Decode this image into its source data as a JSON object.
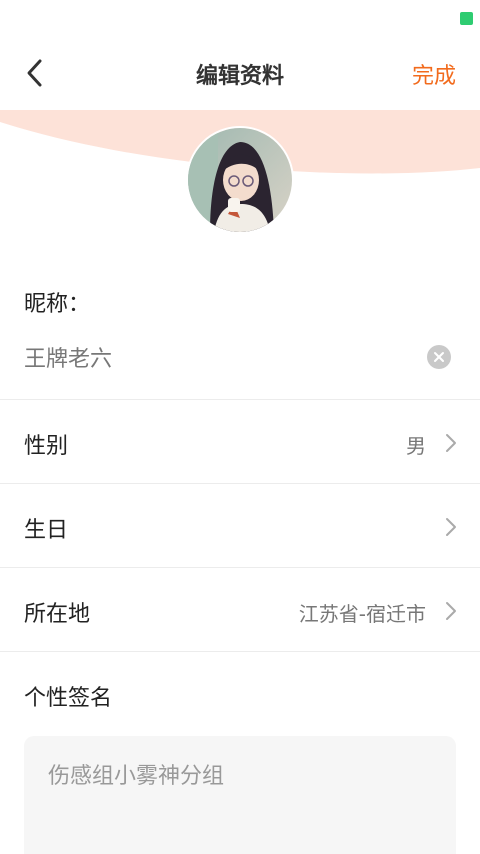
{
  "nav": {
    "title": "编辑资料",
    "done_label": "完成"
  },
  "profile": {
    "nickname_label": "昵称：",
    "nickname_value": "王牌老六"
  },
  "rows": {
    "gender": {
      "label": "性别",
      "value": "男"
    },
    "birthday": {
      "label": "生日",
      "value": ""
    },
    "location": {
      "label": "所在地",
      "value": "江苏省-宿迁市"
    }
  },
  "signature": {
    "label": "个性签名",
    "value": "伤感组小雾神分组"
  },
  "colors": {
    "accent": "#f26b1d",
    "header_wave": "#fde2d8",
    "status_indicator": "#2ecc71"
  }
}
